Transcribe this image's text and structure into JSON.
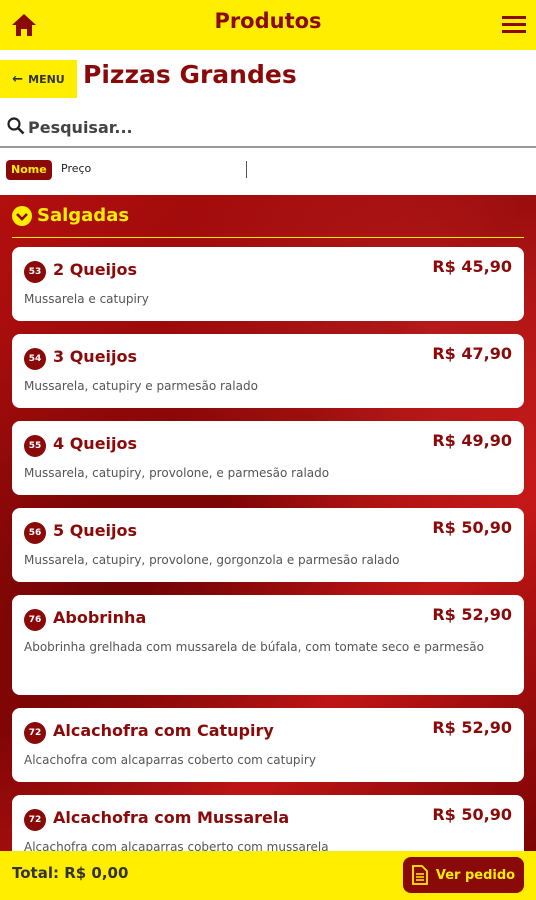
{
  "header": {
    "title": "Produtos",
    "home_icon": "home-icon",
    "menu_icon": "hamburger-menu-icon",
    "bg_color": "#ffee00",
    "title_color": "#8a0a0a"
  },
  "subheader": {
    "back_label": "MENU",
    "page_title": "Pizzas Grandes"
  },
  "search": {
    "placeholder": "Pesquisar..."
  },
  "sort": {
    "active": "Nome",
    "inactive": "Preço"
  },
  "category": {
    "label": "Salgadas",
    "icon": "chevron-down-circle-icon"
  },
  "products": [
    {
      "number": "53",
      "name": "2 Queijos",
      "price": "R$ 45,90",
      "description": "Mussarela e catupiry"
    },
    {
      "number": "54",
      "name": "3 Queijos",
      "price": "R$ 47,90",
      "description": "Mussarela, catupiry e parmesão ralado"
    },
    {
      "number": "55",
      "name": "4 Queijos",
      "price": "R$ 49,90",
      "description": "Mussarela, catupiry, provolone, e parmesão ralado"
    },
    {
      "number": "56",
      "name": "5 Queijos",
      "price": "R$ 50,90",
      "description": "Mussarela, catupiry, provolone, gorgonzola e parmesão ralado"
    },
    {
      "number": "76",
      "name": "Abobrinha",
      "price": "R$ 52,90",
      "description": "Abobrinha grelhada com mussarela de búfala, com tomate seco e parmesão"
    },
    {
      "number": "72",
      "name": "Alcachofra com Catupiry",
      "price": "R$ 52,90",
      "description": "Alcachofra com alcaparras coberto com catupiry"
    },
    {
      "number": "72",
      "name": "Alcachofra com Mussarela",
      "price": "R$ 50,90",
      "description": "Alcachofra com alcaparras coberto com mussarela"
    }
  ],
  "footer": {
    "total": "Total: R$ 0,00",
    "order_button": "Ver pedido",
    "order_icon": "document-icon"
  }
}
